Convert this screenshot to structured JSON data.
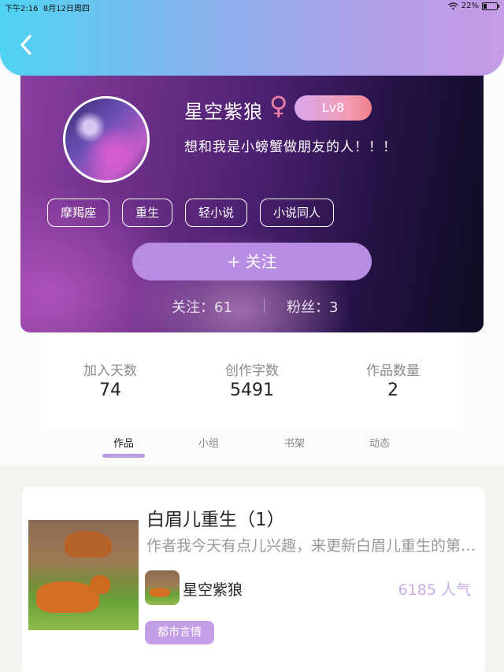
{
  "status_bar": {
    "time": "下午2:16",
    "date": "8月12日周四",
    "battery": "22%"
  },
  "nav": {
    "back_icon": "chevron-left-icon"
  },
  "profile": {
    "name": "星空紫狼",
    "gender_symbol": "♀",
    "level": "Lv8",
    "signature": "想和我是小螃蟹做朋友的人！！！",
    "tags": [
      "摩羯座",
      "重生",
      "轻小说",
      "小说同人"
    ],
    "follow_button": "+  关注",
    "following": "关注：61",
    "fans": "粉丝：3"
  },
  "stats": [
    {
      "label": "加入天数",
      "value": "74"
    },
    {
      "label": "创作字数",
      "value": "5491"
    },
    {
      "label": "作品数量",
      "value": "2"
    }
  ],
  "tabs": [
    {
      "label": "作品",
      "active": true
    },
    {
      "label": "小组",
      "active": false
    },
    {
      "label": "书架",
      "active": false
    },
    {
      "label": "动态",
      "active": false
    }
  ],
  "work": {
    "title": "白眉儿重生（1）",
    "summary": "作者我今天有点儿兴趣，来更新白眉儿重生的第一章",
    "author": "星空紫狼",
    "popularity": "6185 人气",
    "genre": "都市言情"
  },
  "colors": {
    "accent": "#b78ce2",
    "level_badge": "#f29cb4",
    "popularity": "#c9aee6"
  }
}
